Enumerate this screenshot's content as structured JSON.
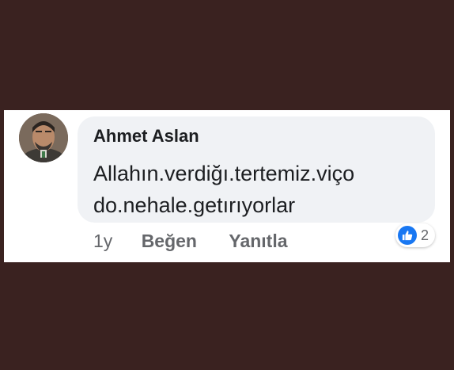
{
  "comment": {
    "author": "Ahmet Aslan",
    "text": "Allahın.verdiğı.tertemiz.viço\ndo.nehale.getırıyorlar",
    "time": "1y",
    "like_label": "Beğen",
    "reply_label": "Yanıtla",
    "reaction_count": "2",
    "reaction_icon": "like-thumb-icon"
  },
  "colors": {
    "background": "#3a2220",
    "card": "#ffffff",
    "bubble": "#f0f2f5",
    "text": "#1c1e21",
    "muted": "#65676b",
    "like_blue": "#1877f2"
  }
}
